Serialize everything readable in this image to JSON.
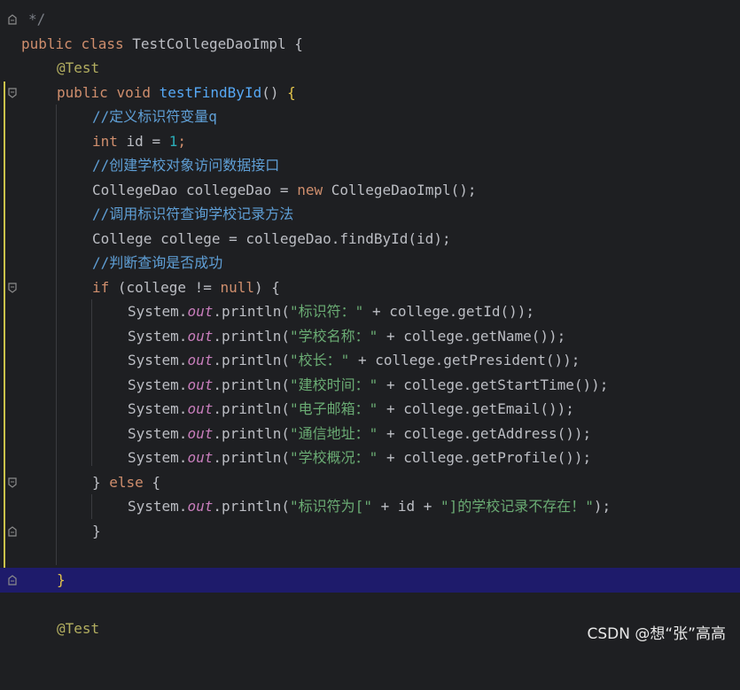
{
  "editor": {
    "lines": {
      "l0": {
        "cm": "*/"
      },
      "l1": {
        "kw1": "public",
        "kw2": "class",
        "name": "TestCollegeDaoImpl",
        "tail": " {"
      },
      "l2": {
        "ann": "@Test"
      },
      "l3": {
        "kw1": "public",
        "kw2": "void",
        "fn": "testFindById",
        "paren": "() ",
        "brace": "{"
      },
      "l4": {
        "cm": "//定义标识符变量q"
      },
      "l5": {
        "kw": "int",
        "mid": " id = ",
        "num": "1",
        "semi": ";"
      },
      "l6": {
        "cm": "//创建学校对象访问数据接口"
      },
      "l7": {
        "pre": "CollegeDao collegeDao = ",
        "kw": "new",
        "post": " CollegeDaoImpl();"
      },
      "l8": {
        "cm": "//调用标识符查询学校记录方法"
      },
      "l9": {
        "text": "College college = collegeDao.findById(id);"
      },
      "l10": {
        "cm": "//判断查询是否成功"
      },
      "l11": {
        "kw": "if",
        "mid": " (college != ",
        "kw2": "null",
        "post": ") {"
      },
      "l12": {
        "str": "\"标识符：\"",
        "post": " + college.getId());"
      },
      "l13": {
        "str": "\"学校名称：\"",
        "post": " + college.getName());"
      },
      "l14": {
        "str": "\"校长：\"",
        "post": " + college.getPresident());"
      },
      "l15": {
        "str": "\"建校时间：\"",
        "post": " + college.getStartTime());"
      },
      "l16": {
        "str": "\"电子邮箱：\"",
        "post": " + college.getEmail());"
      },
      "l17": {
        "str": "\"通信地址：\"",
        "post": " + college.getAddress());"
      },
      "l18": {
        "str": "\"学校概况：\"",
        "post": " + college.getProfile());"
      },
      "l19": {
        "pre": "} ",
        "kw": "else",
        "post": " {"
      },
      "l20": {
        "str1": "\"标识符为[\"",
        "mid": " + id + ",
        "str2": "\"]的学校记录不存在！\"",
        "post": ");"
      },
      "l21": {
        "text": "}"
      },
      "l23": {
        "text": "}"
      },
      "l25": {
        "ann": "@Test"
      }
    },
    "println": {
      "sys": "System.",
      "out": "out",
      "call": ".println("
    }
  },
  "watermark": "CSDN @想“张”高高"
}
